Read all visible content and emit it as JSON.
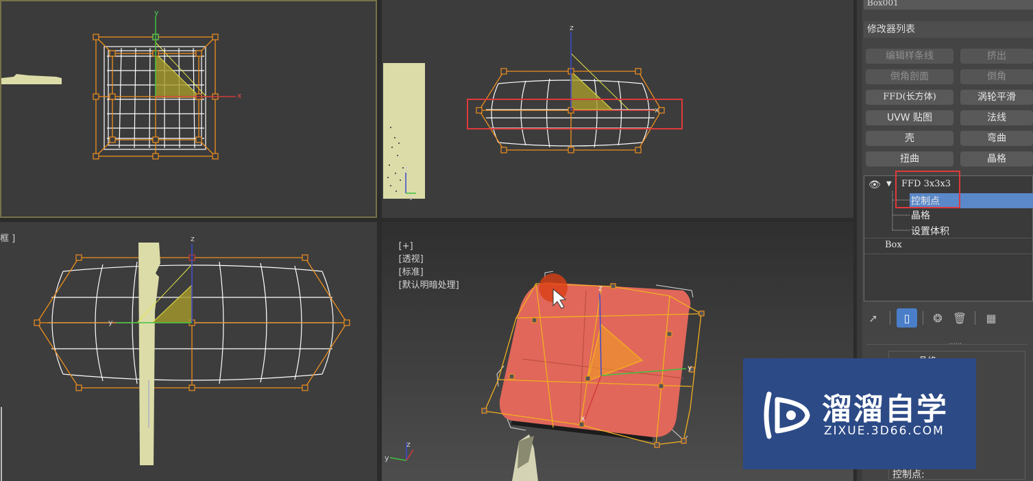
{
  "viewports": {
    "top": {
      "axes": {
        "y": "y",
        "x": "x"
      }
    },
    "front": {
      "axes": {
        "z": "z",
        "x": "x"
      },
      "mini_axes": {
        "z": "z",
        "y": "y"
      }
    },
    "left": {
      "label_partial": "框 ]",
      "axes": {
        "z": "z",
        "y": "y"
      }
    },
    "perspective": {
      "label_parts": [
        "[+]",
        "[透视]",
        "[标准]",
        "[默认明暗处理]"
      ],
      "axes": {
        "z": "z",
        "y": "y",
        "x": "x"
      },
      "mini_axes": {
        "z": "z",
        "y": "y"
      }
    }
  },
  "panel": {
    "object_name": "Box001",
    "modifier_list": "修改器列表",
    "modifier_buttons": [
      {
        "label": "编辑样条线",
        "enabled": false
      },
      {
        "label": "挤出",
        "enabled": false
      },
      {
        "label": "倒角剖面",
        "enabled": false
      },
      {
        "label": "倒角",
        "enabled": false
      },
      {
        "label": "FFD(长方体)",
        "enabled": true
      },
      {
        "label": "涡轮平滑",
        "enabled": true
      },
      {
        "label": "UVW 贴图",
        "enabled": true
      },
      {
        "label": "法线",
        "enabled": true
      },
      {
        "label": "壳",
        "enabled": true
      },
      {
        "label": "弯曲",
        "enabled": true
      },
      {
        "label": "扭曲",
        "enabled": true
      },
      {
        "label": "晶格",
        "enabled": true
      }
    ],
    "stack": {
      "modifier": "FFD 3x3x3",
      "subobjects": [
        "控制点",
        "晶格",
        "设置体积"
      ],
      "selected": "控制点",
      "base": "Box"
    },
    "toolbar_icons": [
      "pin-stack-icon",
      "show-end-result-icon",
      "make-unique-icon",
      "remove-modifier-icon",
      "configure-modifier-sets-icon"
    ],
    "separator": "......",
    "rollout_partial": "晶格",
    "bottom_label": "控制点:"
  },
  "watermark": {
    "title": "溜溜自学",
    "url": "ZIXUE.3D66.COM"
  },
  "colors": {
    "lattice": "#f0901e",
    "selection_highlight": "#e0393a",
    "object_fill": "#e0675a",
    "gizmo": "#d8d84a",
    "stack_selected": "#5a88c8",
    "watermark_bg": "#2c4a86"
  }
}
